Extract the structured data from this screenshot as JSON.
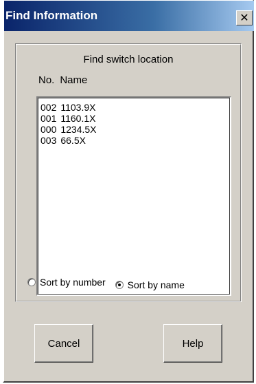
{
  "window": {
    "title": "Find Information",
    "close_glyph": "✕"
  },
  "group": {
    "title": "Find switch location",
    "headers": [
      "No.",
      "Name"
    ]
  },
  "list": {
    "items": [
      {
        "number": "002",
        "name": "1103.9X"
      },
      {
        "number": "001",
        "name": "1160.1X"
      },
      {
        "number": "000",
        "name": "1234.5X"
      },
      {
        "number": "003",
        "name": "66.5X"
      }
    ]
  },
  "sort": {
    "options": [
      {
        "label": "Sort by number",
        "selected": false
      },
      {
        "label": "Sort by name",
        "selected": true
      }
    ]
  },
  "buttons": {
    "cancel": "Cancel",
    "help": "Help"
  },
  "icons": {
    "close": "close-icon",
    "radio": "radio-button-icon"
  }
}
